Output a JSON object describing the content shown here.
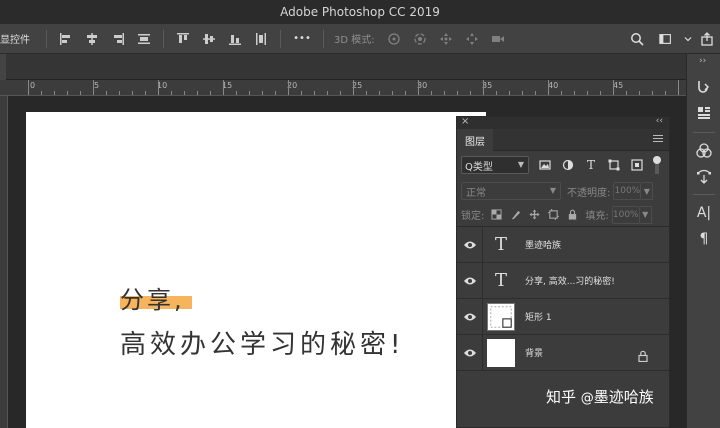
{
  "window": {
    "title": "Adobe Photoshop CC 2019"
  },
  "options_bar": {
    "label": "显控件",
    "more": "•••",
    "mode_3d_label": "3D 模式:"
  },
  "ruler": {
    "marks": [
      "0",
      "5",
      "10",
      "15",
      "20",
      "25",
      "30",
      "35",
      "40",
      "45"
    ]
  },
  "canvas": {
    "line1": "分享,",
    "line2": "高效办公学习的秘密!",
    "highlight_color": "#f7b45c"
  },
  "layers_panel": {
    "close_glyph": "×",
    "collapse_glyph": "‹‹",
    "tab_label": "图层",
    "filter_kind": "Q类型",
    "blend_mode": "正常",
    "opacity_label": "不透明度:",
    "opacity_value": "100%",
    "lock_label": "锁定:",
    "fill_label": "填充:",
    "fill_value": "100%",
    "layers": [
      {
        "name": "墨迹哈族",
        "kind": "text",
        "thumb": "T"
      },
      {
        "name": "分享, 高效...习的秘密!",
        "kind": "text",
        "thumb": "T"
      },
      {
        "name": "矩形 1",
        "kind": "shape"
      },
      {
        "name": "背景",
        "kind": "background",
        "locked": true
      }
    ]
  },
  "watermark": {
    "brand": "知乎",
    "at": "@",
    "author": "墨迹哈族"
  }
}
